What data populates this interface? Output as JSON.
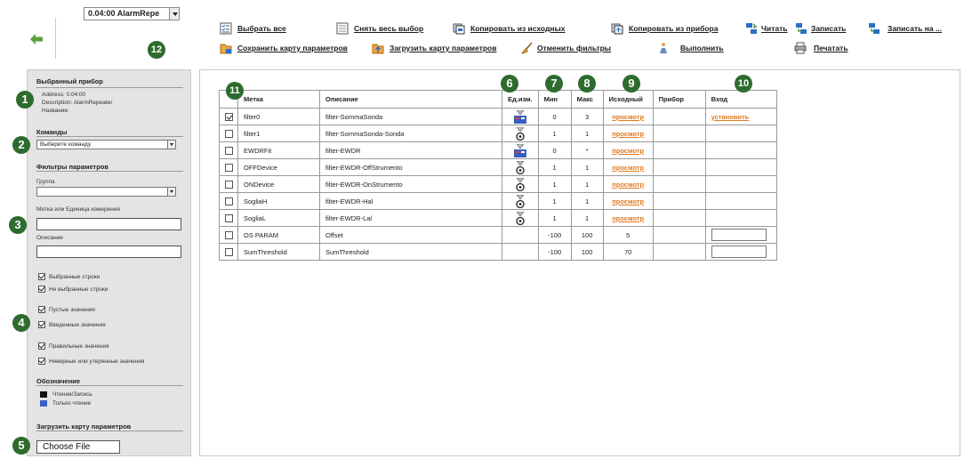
{
  "topbar": {
    "device_select": "0.04:00 AlarmRepe",
    "toolbar": {
      "select_all": "Выбрать все",
      "deselect_all": "Снять весь выбор",
      "copy_from_source": "Копировать из исходных",
      "copy_from_device": "Копировать из прибора",
      "read": "Читать",
      "write": "Записать",
      "write_to": "Записать на ...",
      "save_param_map": "Сохранить карту параметров",
      "load_param_map": "Загрузить карту параметров",
      "clear_filters": "Отменить фильтры",
      "execute": "Выполнить",
      "print": "Печатать"
    }
  },
  "badges": [
    "1",
    "2",
    "3",
    "4",
    "5",
    "6",
    "7",
    "8",
    "9",
    "10",
    "11",
    "12"
  ],
  "left_panel": {
    "device_heading": "Выбранный прибор",
    "address": "Address:  0.04:00",
    "description": "Description:  AlarmRepeater",
    "name": "Название:",
    "commands_heading": "Команды",
    "command_select": "Выберите команду",
    "filters_heading": "Фильтры параметров",
    "group_label": "Группа",
    "group_select": "",
    "label_or_unit_label": "Метка или Единица измерения",
    "label_or_unit_value": "",
    "description_label": "Описание",
    "description_value": "",
    "checkboxes": [
      {
        "label": "Выбранные строки",
        "checked": true
      },
      {
        "label": "Не выбранные строки",
        "checked": true
      },
      {
        "label": "Пустые значения",
        "checked": true
      },
      {
        "label": "Введенные значения",
        "checked": true
      },
      {
        "label": "Правильные значения",
        "checked": true
      },
      {
        "label": "Неверные или утерянные значения",
        "checked": true
      }
    ],
    "legend_heading": "Обозначение",
    "legend": [
      {
        "label": "Чтение/Запись",
        "color": "#111111"
      },
      {
        "label": "Только чтение",
        "color": "#3a5ec0"
      }
    ],
    "load_map_heading": "Загрузить карту параметров",
    "choose_file": "Choose File"
  },
  "table": {
    "headers": [
      "",
      "Метка",
      "Описание",
      "Ед.изм.",
      "Мин",
      "Макс",
      "Исходный",
      "Прибор",
      "Вход"
    ],
    "rows": [
      {
        "checked": true,
        "label": "filter0",
        "desc": "filter-SommaSonda",
        "unit": "flag",
        "min": "0",
        "max": "3",
        "source": "просмотр",
        "device": "",
        "input": "установить",
        "input_type": "link"
      },
      {
        "checked": false,
        "label": "filter1",
        "desc": "filter-SommaSonda-Sonda",
        "unit": "probe",
        "min": "1",
        "max": "1",
        "source": "просмотр",
        "device": "",
        "input": "",
        "input_type": "none"
      },
      {
        "checked": false,
        "label": "EWDRFit",
        "desc": "filter-EWDR",
        "unit": "flag",
        "min": "0",
        "max": "*",
        "source": "просмотр",
        "device": "",
        "input": "",
        "input_type": "none"
      },
      {
        "checked": false,
        "label": "OFFDevice",
        "desc": "filter-EWDR-OffStrumento",
        "unit": "probe",
        "min": "1",
        "max": "1",
        "source": "просмотр",
        "device": "",
        "input": "",
        "input_type": "none"
      },
      {
        "checked": false,
        "label": "ONDevice",
        "desc": "filter-EWDR-OnStrumento",
        "unit": "probe",
        "min": "1",
        "max": "1",
        "source": "просмотр",
        "device": "",
        "input": "",
        "input_type": "none"
      },
      {
        "checked": false,
        "label": "SogliaH",
        "desc": "filter-EWDR-Hal",
        "unit": "probe",
        "min": "1",
        "max": "1",
        "source": "просмотр",
        "device": "",
        "input": "",
        "input_type": "none"
      },
      {
        "checked": false,
        "label": "SogliaL",
        "desc": "filter-EWDR-Lal",
        "unit": "probe",
        "min": "1",
        "max": "1",
        "source": "просмотр",
        "device": "",
        "input": "",
        "input_type": "none"
      },
      {
        "checked": false,
        "label": "OS PARAM",
        "desc": "Offset",
        "unit": "",
        "min": "-100",
        "max": "100",
        "source": "5",
        "device": "",
        "input": "",
        "input_type": "field"
      },
      {
        "checked": false,
        "label": "SumThreshold",
        "desc": "SumThreshold",
        "unit": "",
        "min": "-100",
        "max": "100",
        "source": "70",
        "device": "",
        "input": "",
        "input_type": "field"
      }
    ]
  },
  "colors": {
    "badge": "#2e6b2e",
    "link_orange": "#e07a1e",
    "panel_gray": "#e4e4e4",
    "arrow_green": "#5aa03c"
  }
}
